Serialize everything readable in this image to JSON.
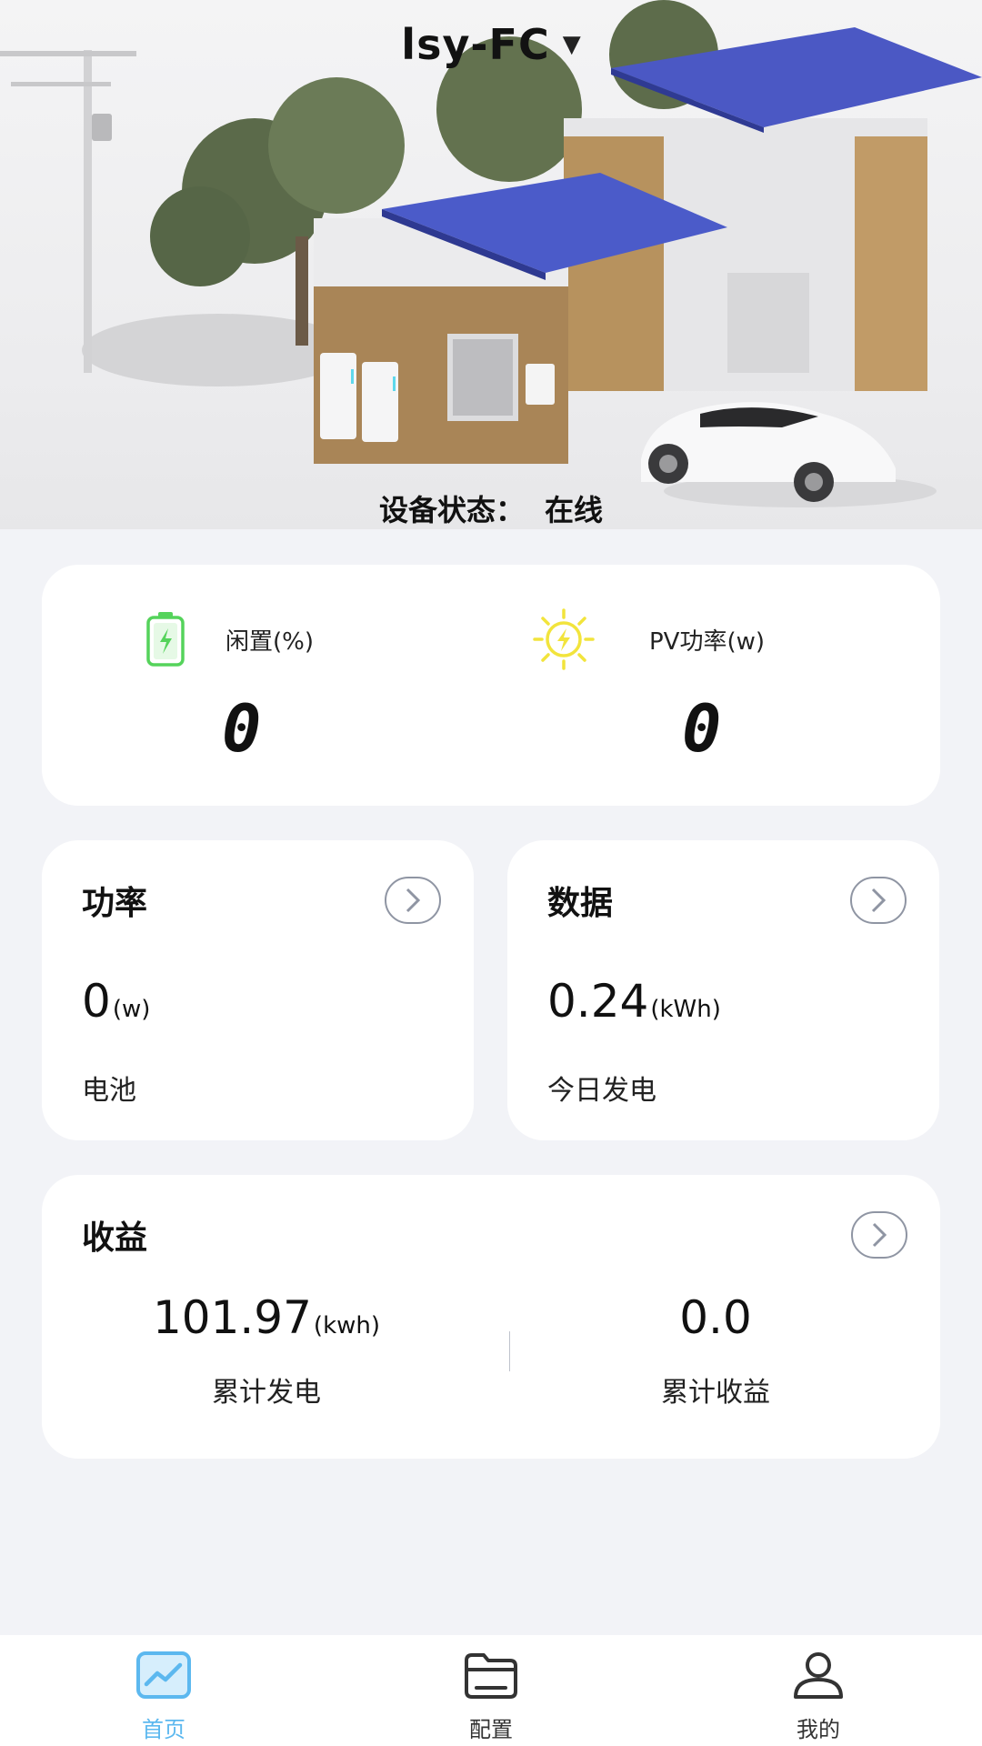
{
  "header": {
    "device_name": "lsy-FC",
    "status_label": "设备状态：",
    "status_value": "在线"
  },
  "summary": {
    "battery": {
      "label": "闲置(%)",
      "value": "0",
      "icon": "battery-icon",
      "color": "#55d35b"
    },
    "pv": {
      "label": "PV功率(w)",
      "value": "0",
      "icon": "sun-lightning-icon",
      "color": "#f2e43c"
    }
  },
  "power_card": {
    "title": "功率",
    "value": "0",
    "unit": "(w)",
    "subtitle": "电池"
  },
  "data_card": {
    "title": "数据",
    "value": "0.24",
    "unit": "(kWh)",
    "subtitle": "今日发电"
  },
  "income_card": {
    "title": "收益",
    "total_generation": {
      "value": "101.97",
      "unit": "(kwh)",
      "label": "累计发电"
    },
    "total_income": {
      "value": "0.0",
      "label": "累计收益"
    }
  },
  "tabs": [
    {
      "label": "首页",
      "icon": "chart-icon",
      "active": true
    },
    {
      "label": "配置",
      "icon": "folder-icon",
      "active": false
    },
    {
      "label": "我的",
      "icon": "user-icon",
      "active": false
    }
  ],
  "colors": {
    "accent": "#5cb8ef",
    "background": "#f2f3f7",
    "card": "#ffffff"
  }
}
